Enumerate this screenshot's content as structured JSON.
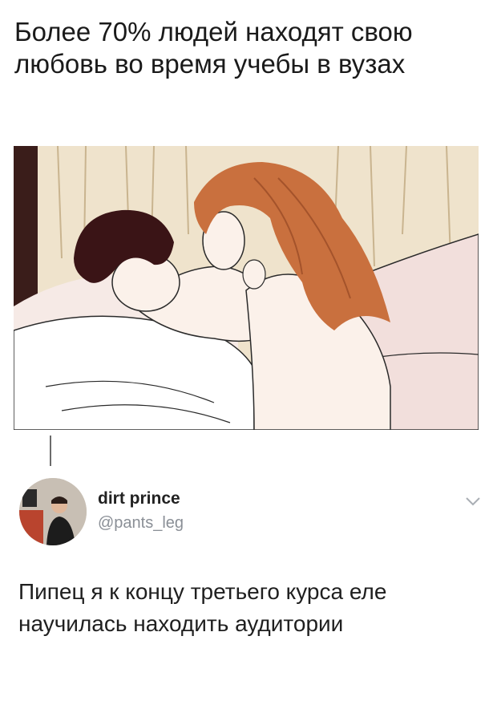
{
  "post": {
    "text": "Более 70% людей находят свою любовь во время учебы в вузах"
  },
  "reply": {
    "display_name": "dirt prince",
    "handle": "@pants_leg",
    "text": "Пипец я к концу третьего курса еле научилась находить аудитории"
  },
  "icons": {
    "more": "chevron-down-icon"
  },
  "colors": {
    "text": "#1a1a1a",
    "handle": "#8a8f96",
    "thread_line": "#6b6b6b",
    "hair": "#c9703e"
  }
}
